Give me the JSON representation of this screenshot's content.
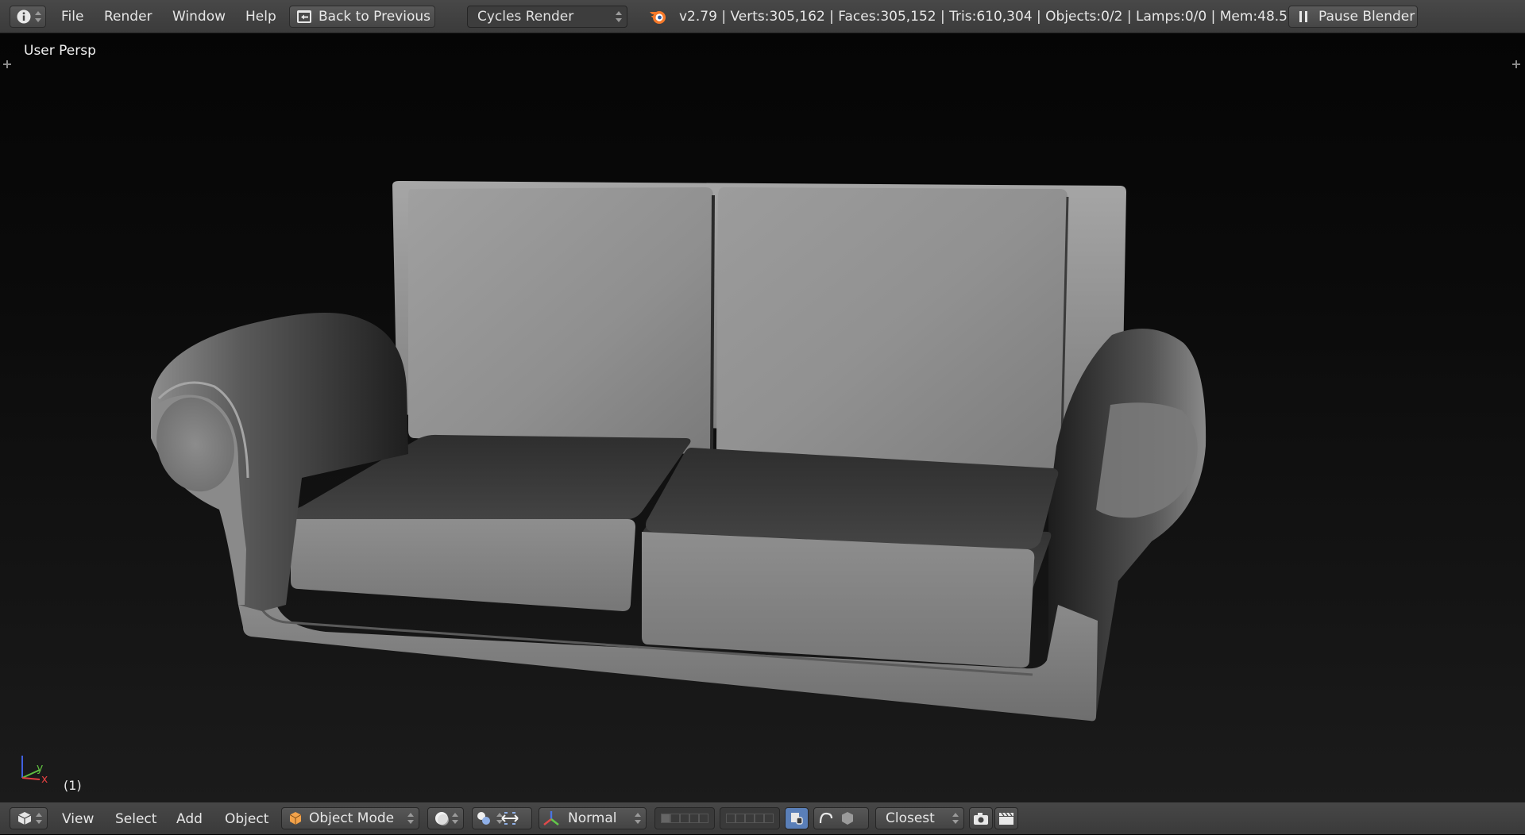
{
  "top_menu": {
    "items": [
      "File",
      "Render",
      "Window",
      "Help"
    ],
    "back_button": "Back to Previous",
    "render_engine": "Cycles Render",
    "stats": "v2.79 | Verts:305,162 | Faces:305,152 | Tris:610,304 | Objects:0/2 | Lamps:0/0 | Mem:48.52M",
    "pause_button": "Pause Blender"
  },
  "viewport": {
    "view_label": "User Persp",
    "frame_label": "(1)",
    "axis_x": "x",
    "axis_y": "y"
  },
  "bottom_menu": {
    "items": [
      "View",
      "Select",
      "Add",
      "Object"
    ],
    "mode": "Object Mode",
    "orientation": "Normal",
    "snap_target": "Closest"
  },
  "colors": {
    "header_bg": "#444444",
    "viewport_bg": "#0a0a0a",
    "sofa_light": "#9a9a9a",
    "sofa_dark": "#3a3a3a",
    "blender_orange": "#f5792a",
    "axis_x": "#e04040",
    "axis_y": "#60c040",
    "axis_z": "#4060e0"
  }
}
